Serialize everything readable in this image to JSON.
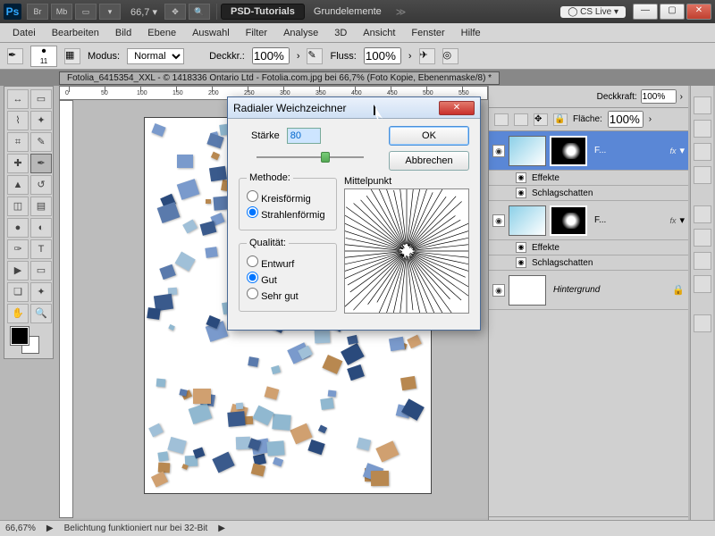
{
  "titlebar": {
    "app_abbrev": "Ps",
    "btn_br": "Br",
    "btn_mb": "Mb",
    "zoom": "66,7",
    "workspace_active": "PSD-Tutorials",
    "workspace_other": "Grundelemente",
    "cslive": "CS Live"
  },
  "menu": [
    "Datei",
    "Bearbeiten",
    "Bild",
    "Ebene",
    "Auswahl",
    "Filter",
    "Analyse",
    "3D",
    "Ansicht",
    "Fenster",
    "Hilfe"
  ],
  "options": {
    "brush_size": "11",
    "mode_label": "Modus:",
    "mode_value": "Normal",
    "opacity_label": "Deckkr.:",
    "opacity_value": "100%",
    "flow_label": "Fluss:",
    "flow_value": "100%"
  },
  "doc_tab": "Fotolia_6415354_XXL - © 1418336 Ontario Ltd - Fotolia.com.jpg bei 66,7% (Foto Kopie, Ebenenmaske/8) *",
  "ruler_marks": [
    "0",
    "50",
    "100",
    "150",
    "200",
    "250",
    "300",
    "350",
    "400",
    "450",
    "500",
    "550"
  ],
  "right_panel": {
    "opacity_label": "Deckkraft:",
    "opacity_value": "100%",
    "fill_label": "Fläche:",
    "fill_value": "100%",
    "layers": [
      {
        "name": "F...",
        "selected": true,
        "fx": "fx"
      },
      {
        "name": "F...",
        "selected": false,
        "fx": "fx"
      }
    ],
    "effects_label": "Effekte",
    "dropshadow_label": "Schlagschatten",
    "background_label": "Hintergrund"
  },
  "dialog": {
    "title": "Radialer Weichzeichner",
    "amount_label": "Stärke",
    "amount_value": "80",
    "ok": "OK",
    "cancel": "Abbrechen",
    "method_legend": "Methode:",
    "method_spin": "Kreisförmig",
    "method_zoom": "Strahlenförmig",
    "method_selected": "zoom",
    "quality_legend": "Qualität:",
    "quality_draft": "Entwurf",
    "quality_good": "Gut",
    "quality_best": "Sehr gut",
    "quality_selected": "good",
    "center_label": "Mittelpunkt"
  },
  "status": {
    "zoom": "66,67%",
    "info": "Belichtung funktioniert nur bei 32-Bit"
  },
  "tools": [
    "⬚",
    "▭",
    "⬚",
    "✎",
    "✂",
    "✎",
    "⌖",
    "↯",
    "✦",
    "▤",
    "✜",
    "⟲",
    "⬚",
    "⬚",
    "●",
    "T",
    "▶",
    "⬚",
    "✥",
    "⤧",
    "◑",
    "Q"
  ]
}
